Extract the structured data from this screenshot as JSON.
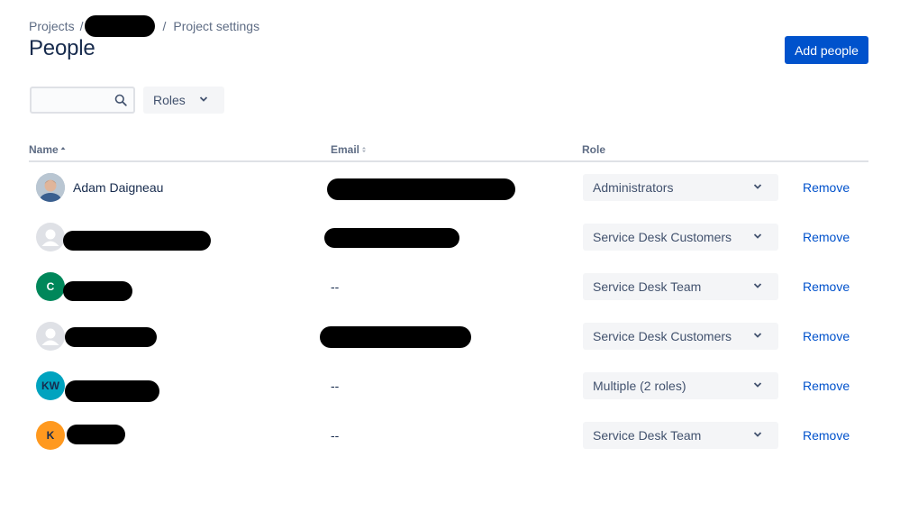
{
  "breadcrumb": {
    "projects": "Projects",
    "separator": "/",
    "current": "Project settings"
  },
  "page": {
    "title": "People",
    "add_button": "Add people"
  },
  "filters": {
    "search_placeholder": "",
    "roles_label": "Roles"
  },
  "table": {
    "headers": {
      "name": "Name",
      "email": "Email",
      "role": "Role"
    },
    "rows": [
      {
        "avatar": "photo",
        "initials": "",
        "name": "Adam Daigneau",
        "email": "",
        "role": "Administrators",
        "action": "Remove"
      },
      {
        "avatar": "generic",
        "initials": "",
        "name": "",
        "email": "",
        "role": "Service Desk Customers",
        "action": "Remove"
      },
      {
        "avatar": "letter",
        "initials": "C",
        "name": "",
        "email": "--",
        "role": "Service Desk Team",
        "action": "Remove"
      },
      {
        "avatar": "generic",
        "initials": "",
        "name": "",
        "email": "",
        "role": "Service Desk Customers",
        "action": "Remove"
      },
      {
        "avatar": "letter",
        "initials": "KW",
        "name": "",
        "email": "--",
        "role": "Multiple (2 roles)",
        "action": "Remove"
      },
      {
        "avatar": "letter",
        "initials": "K",
        "name": "",
        "email": "--",
        "role": "Service Desk Team",
        "action": "Remove"
      }
    ]
  },
  "colors": {
    "primary": "#0052cc",
    "text": "#172b4d",
    "subtle": "#5e6c84",
    "avatar_c": "#00875a",
    "avatar_kw": "#00a3bf",
    "avatar_k": "#ff991f"
  }
}
